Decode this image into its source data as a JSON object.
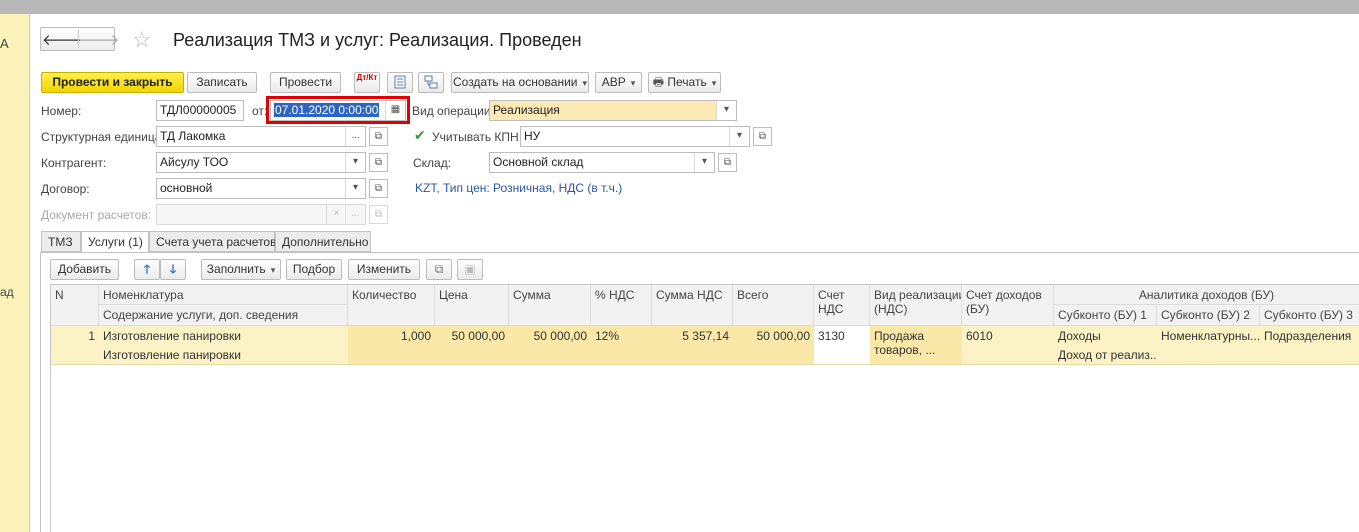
{
  "title": "Реализация ТМЗ и услуг: Реализация. Проведен",
  "left_panel": {
    "top_letter": "А",
    "mid_text": "ад"
  },
  "nav": {
    "back": "🡐",
    "forward": "🡒"
  },
  "toolbar": {
    "post_close": "Провести и закрыть",
    "save": "Записать",
    "post": "Провести",
    "dtkt_icon": "Дт/Кт",
    "create_based": "Создать на основании",
    "avr": "АВР",
    "print": "Печать"
  },
  "form": {
    "number_label": "Номер:",
    "number_value": "ТДЛ00000005",
    "from_label": "от:",
    "date_value": "07.01.2020  0:00:00",
    "op_type_label": "Вид операции:",
    "op_type_value": "Реализация",
    "struct_unit_label": "Структурная единица:",
    "struct_unit_value": "ТД Лакомка",
    "kpn_label": "Учитывать КПН",
    "kpn_value": "НУ",
    "counterparty_label": "Контрагент:",
    "counterparty_value": "Айсулу ТОО",
    "warehouse_label": "Склад:",
    "warehouse_value": "Основной склад",
    "contract_label": "Договор:",
    "contract_value": "основной",
    "price_link": "KZT, Тип цен: Розничная, НДС (в т.ч.)",
    "settlement_doc_label": "Документ расчетов:"
  },
  "tabs": [
    "ТМЗ",
    "Услуги (1)",
    "Счета учета расчетов",
    "Дополнительно"
  ],
  "table_toolbar": {
    "add": "Добавить",
    "up": "🡑",
    "down": "🡓",
    "fill": "Заполнить",
    "select": "Подбор",
    "change": "Изменить"
  },
  "table": {
    "headers": {
      "n": "N",
      "nomenclature": "Номенклатура",
      "content": "Содержание услуги, доп. сведения",
      "qty": "Количество",
      "price": "Цена",
      "sum": "Сумма",
      "vat_rate": "% НДС",
      "vat_sum": "Сумма НДС",
      "total": "Всего",
      "vat_acc_1": "Счет",
      "vat_acc_2": "НДС",
      "sale_type_1": "Вид реализации",
      "sale_type_2": "(НДС)",
      "income_acc_1": "Счет доходов",
      "income_acc_2": "(БУ)",
      "analytics": "Аналитика доходов (БУ)",
      "sub1": "Субконто (БУ) 1",
      "sub2": "Субконто (БУ) 2",
      "sub3": "Субконто (БУ) 3"
    },
    "rows": [
      {
        "n": "1",
        "nomenclature": "Изготовление панировки",
        "content": "Изготовление панировки",
        "qty": "1,000",
        "price": "50 000,00",
        "sum": "50 000,00",
        "vat_rate": "12%",
        "vat_sum": "5 357,14",
        "total": "50 000,00",
        "vat_acc": "3130",
        "sale_type_1": "Продажа",
        "sale_type_2": "товаров, ...",
        "income_acc": "6010",
        "sub1": "Доходы",
        "sub1_b": "Доход от реализ...",
        "sub2": "Номенклатурны...",
        "sub3": "Подразделения"
      }
    ]
  }
}
